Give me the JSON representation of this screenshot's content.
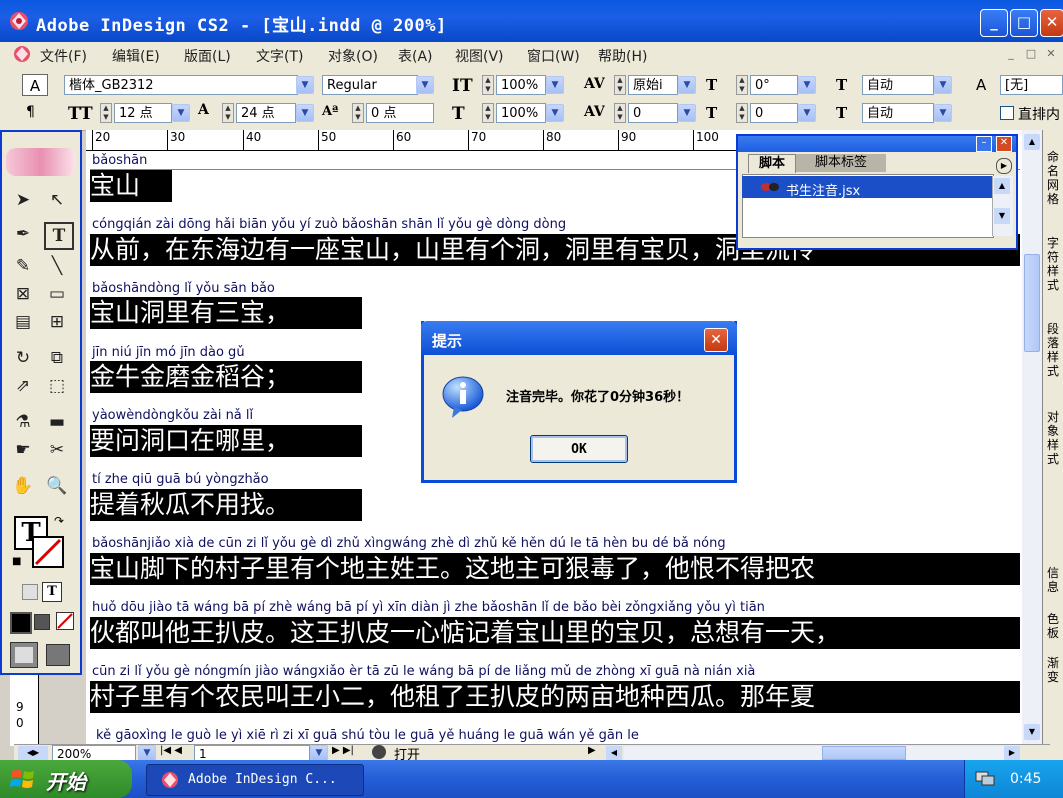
{
  "window": {
    "title": "Adobe InDesign CS2 - [宝山.indd @ 200%]",
    "minimize": "_",
    "maximize": "□",
    "close": "✕"
  },
  "menu": {
    "items": [
      "文件(F)",
      "编辑(E)",
      "版面(L)",
      "文字(T)",
      "对象(O)",
      "表(A)",
      "视图(V)",
      "窗口(W)",
      "帮助(H)"
    ],
    "mdi": [
      "_",
      "□",
      "✕"
    ]
  },
  "control_panel": {
    "font_family": "楷体_GB2312",
    "font_style": "Regular",
    "font_size": "12 点",
    "leading": "24 点",
    "baseline": "0 点",
    "v_scale": "100%",
    "h_scale": "100%",
    "kerning": "原始i",
    "tracking": "0",
    "skew": "0°",
    "spacing": "0",
    "auto1": "自动",
    "auto2": "自动",
    "char_style": "A",
    "none_label": "[无]",
    "checkbox_label": "直排内"
  },
  "ruler": {
    "ticks": [
      "20",
      "30",
      "40",
      "50",
      "60",
      "70",
      "80",
      "90",
      "100"
    ],
    "v_ticks": [
      "9",
      "0"
    ]
  },
  "document": {
    "lines": [
      {
        "pinyin": "bǎoshān",
        "hanzi": "宝山"
      },
      {
        "pinyin": "cóngqián      zài dōng hǎi biān yǒu  yí  zuò bǎoshān     shān  lǐ   yǒu gè dòng      dòng",
        "hanzi": "从前，在东海边有一座宝山，山里有个洞，洞里有宝贝，洞里流传"
      },
      {
        "pinyin": "bǎoshāndòng   lǐ   yǒu sān bǎo",
        "hanzi": "宝山洞里有三宝，"
      },
      {
        "pinyin": " jīn  niú  jīn  mó  jīn  dào  gǔ",
        "hanzi": "金牛金磨金稻谷；"
      },
      {
        "pinyin": "yàowèndòngkǒu zài  nǎ    lǐ",
        "hanzi": "要问洞口在哪里，"
      },
      {
        "pinyin": " tí  zhe  qiū  guā  bú  yòngzhǎo",
        "hanzi": "提着秋瓜不用找。"
      },
      {
        "pinyin": "bǎoshānjiǎo xià  de  cūn   zi    lǐ   yǒu  gè   dì  zhǔ xìngwáng       zhè  dì  zhǔ  kě  hěn  dú   le          tā  hèn  bu  dé  bǎ nóng",
        "hanzi": "宝山脚下的村子里有个地主姓王。这地主可狠毒了，他恨不得把农"
      },
      {
        "pinyin": "huǒ dōu jiào  tā  wáng bā   pí        zhè wáng bā   pí    yì   xīn diàn   jì   zhe bǎoshān   lǐ    de  bǎo bèi       zǒngxiǎng yǒu  yì  tiān",
        "hanzi": "伙都叫他王扒皮。这王扒皮一心惦记着宝山里的宝贝，总想有一天，"
      },
      {
        "pinyin": "cūn   zi    lǐ   yǒu gè nóngmín jiào wángxiǎo  èr          tā   zū   le  wáng bā   pí   de liǎng mǔ  de zhòng  xī  guā        nà  nián  xià",
        "hanzi": "村子里有个农民叫王小二，他租了王扒皮的两亩地种西瓜。那年夏"
      },
      {
        "pinyin": "kě gāoxìng  le         guò  le   yì   xiē   rì    zi         xī  guā shú tòu  le          guā  yě  huáng  le        guā wán  yě  gān  le",
        "hanzi": ""
      }
    ]
  },
  "scripts_panel": {
    "tab_active": "脚本",
    "tab_other": "脚本标签",
    "script_item": "书生注音.jsx"
  },
  "right_dock": {
    "tabs": [
      "命名网格",
      "字符样式",
      "段落样式",
      "对象样式",
      "信息",
      "色板",
      "渐变"
    ]
  },
  "status": {
    "zoom": "200%",
    "page": "1",
    "state": "打开"
  },
  "dialog": {
    "title": "提示",
    "message": "注音完毕。你花了0分钟36秒！",
    "ok": "OK",
    "close": "✕"
  },
  "taskbar": {
    "start": "开始",
    "task": "Adobe InDesign C...",
    "time": "0:45"
  }
}
